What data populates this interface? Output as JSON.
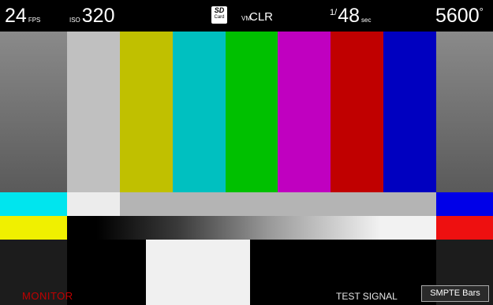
{
  "status_bar": {
    "fps_value": "24",
    "fps_unit": "FPS",
    "iso_label": "ISO",
    "iso_value": "320",
    "media_icon": "sd-card-icon",
    "sd_text": "SD",
    "card_text": "Card",
    "vm_label": "VM",
    "clr_label": "CLR",
    "shutter_numerator": "1/",
    "shutter_value": "48",
    "shutter_unit": "sec",
    "white_balance": "5600",
    "wb_degree": "°"
  },
  "test_pattern": {
    "name": "SMPTE color bars",
    "main_bars": [
      "#7a7a7a",
      "#c0c0c0",
      "#c0c000",
      "#00c0c0",
      "#00c000",
      "#c000c0",
      "#c00000",
      "#0000c0",
      "#7a7a7a"
    ],
    "left_row2": "#00e5ee",
    "left_row3": "#f0f000",
    "right_row2": "#0000e8",
    "right_row3": "#ee1010",
    "white_block": "#f0f0f0"
  },
  "bottom": {
    "monitor_label": "MONITOR",
    "test_signal_label": "TEST SIGNAL",
    "smpte_button": "SMPTE Bars"
  }
}
